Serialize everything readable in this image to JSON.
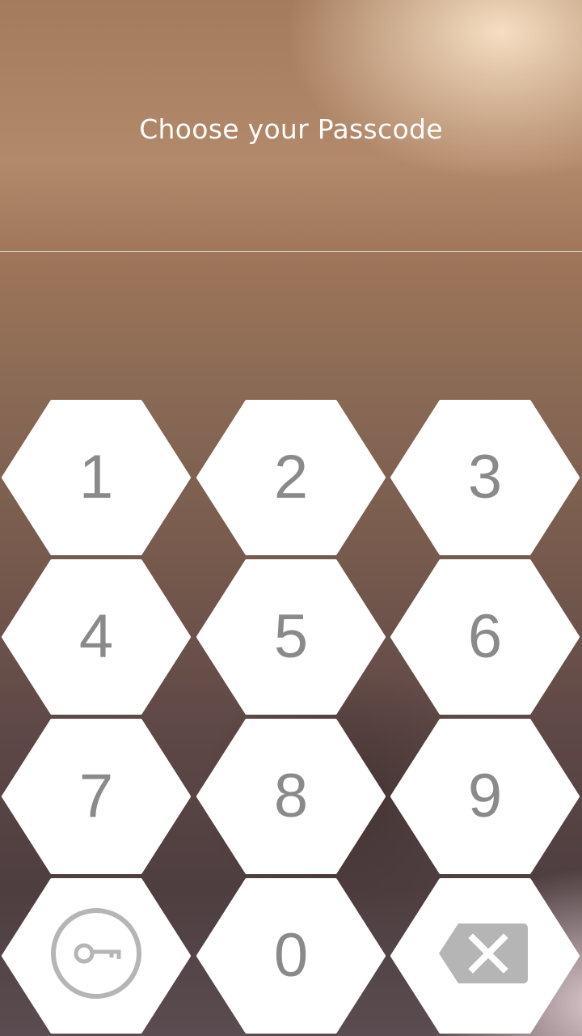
{
  "header": {
    "title": "Choose your Passcode"
  },
  "keypad": {
    "keys": [
      {
        "label": "1"
      },
      {
        "label": "2"
      },
      {
        "label": "3"
      },
      {
        "label": "4"
      },
      {
        "label": "5"
      },
      {
        "label": "6"
      },
      {
        "label": "7"
      },
      {
        "label": "8"
      },
      {
        "label": "9"
      },
      {
        "label": "0"
      }
    ],
    "extra_key_icon": "key-icon",
    "delete_key_icon": "backspace-icon"
  },
  "colors": {
    "key_fill": "#ffffff",
    "digit": "#8a8a8a",
    "icon": "#b5b5b5",
    "title": "#ffffff"
  }
}
